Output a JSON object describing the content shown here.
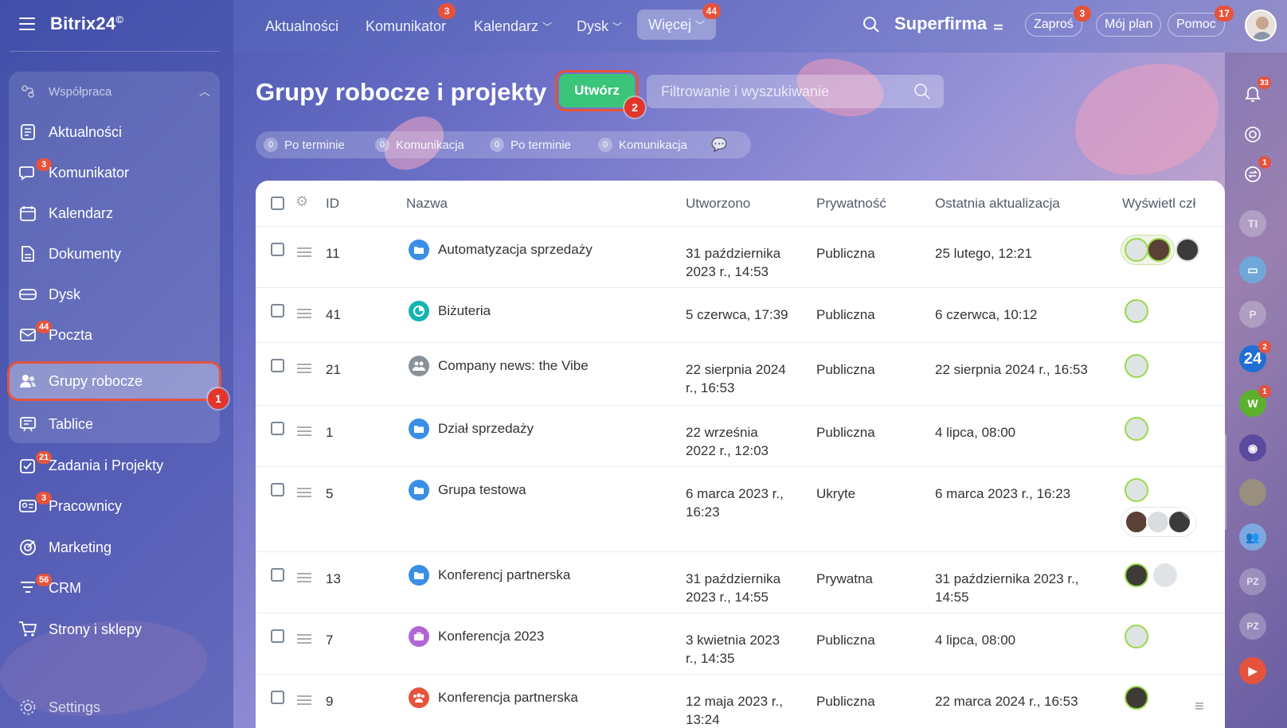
{
  "brand": {
    "name": "Bitrix24",
    "mark": "©"
  },
  "sidebar": {
    "group_label": "Współpraca",
    "items": [
      {
        "label": "Aktualności",
        "icon": "news-icon",
        "badge": ""
      },
      {
        "label": "Komunikator",
        "icon": "chat-icon",
        "badge": "3"
      },
      {
        "label": "Kalendarz",
        "icon": "calendar-icon",
        "badge": ""
      },
      {
        "label": "Dokumenty",
        "icon": "document-icon",
        "badge": ""
      },
      {
        "label": "Dysk",
        "icon": "disk-icon",
        "badge": ""
      },
      {
        "label": "Poczta",
        "icon": "mail-icon",
        "badge": "44"
      },
      {
        "label": "Grupy robocze",
        "icon": "people-icon",
        "badge": "",
        "active": true
      },
      {
        "label": "Tablice",
        "icon": "board-icon",
        "badge": ""
      },
      {
        "label": "Zadania i Projekty",
        "icon": "tasks-icon",
        "badge": "21"
      },
      {
        "label": "Pracownicy",
        "icon": "employees-icon",
        "badge": "3"
      },
      {
        "label": "Marketing",
        "icon": "target-icon",
        "badge": ""
      },
      {
        "label": "CRM",
        "icon": "crm-funnel-icon",
        "badge": "56"
      },
      {
        "label": "Strony i sklepy",
        "icon": "cart-icon",
        "badge": ""
      }
    ],
    "settings_label": "Settings",
    "step1": "1"
  },
  "topnav": {
    "items": [
      {
        "label": "Aktualności",
        "badge": ""
      },
      {
        "label": "Komunikator",
        "badge": "3"
      },
      {
        "label": "Kalendarz",
        "badge": ""
      },
      {
        "label": "Dysk",
        "badge": ""
      },
      {
        "label": "Więcej",
        "badge": "44"
      }
    ],
    "company": "Superfirma",
    "invite": "Zaproś",
    "invite_badge": "3",
    "plan": "Mój plan",
    "help": "Pomoc",
    "help_badge": "17"
  },
  "page": {
    "title": "Grupy robocze i projekty",
    "create_label": "Utwórz",
    "step2": "2",
    "search_placeholder": "Filtrowanie i wyszukiwanie",
    "counters": [
      {
        "n": "0",
        "label": "Po terminie"
      },
      {
        "n": "0",
        "label": "Komunikacja"
      },
      {
        "n": "0",
        "label": "Po terminie"
      },
      {
        "n": "0",
        "label": "Komunikacja"
      }
    ]
  },
  "table": {
    "columns": [
      "ID",
      "Nazwa",
      "Utworzono",
      "Prywatność",
      "Ostatnia aktualizacja",
      "Wyświetl czł"
    ],
    "rows": [
      {
        "id": "11",
        "name": "Automatyzacja sprzedaży",
        "icon": "folder-icon",
        "icon_color": "#3b8ee6",
        "created": [
          "31 października",
          "2023 r., 14:53"
        ],
        "privacy": "Publiczna",
        "updated": [
          "25 lutego, 12:21"
        ]
      },
      {
        "id": "41",
        "name": "Biżuteria",
        "icon": "pie-icon",
        "icon_color": "#12b5b0",
        "created": [
          "5 czerwca, 17:39"
        ],
        "privacy": "Publiczna",
        "updated": [
          "6 czerwca, 10:12"
        ]
      },
      {
        "id": "21",
        "name": "Company news: the Vibe",
        "icon": "group-icon",
        "icon_color": "#8a9199",
        "created": [
          "22 sierpnia 2024",
          "r., 16:53"
        ],
        "privacy": "Publiczna",
        "updated": [
          "22 sierpnia 2024 r., 16:53"
        ]
      },
      {
        "id": "1",
        "name": "Dział sprzedaży",
        "icon": "folder-icon",
        "icon_color": "#3b8ee6",
        "created": [
          "22 września",
          "2022 r., 12:03"
        ],
        "privacy": "Publiczna",
        "updated": [
          "4 lipca, 08:00"
        ]
      },
      {
        "id": "5",
        "name": "Grupa testowa",
        "icon": "folder-icon",
        "icon_color": "#3b8ee6",
        "created": [
          "6 marca 2023 r.,",
          "16:23"
        ],
        "privacy": "Ukryte",
        "updated": [
          "6 marca 2023 r., 16:23"
        ]
      },
      {
        "id": "13",
        "name": "Konferencj partnerska",
        "icon": "folder-icon",
        "icon_color": "#3b8ee6",
        "created": [
          "31 października",
          "2023 r., 14:55"
        ],
        "privacy": "Prywatna",
        "updated": [
          "31 października 2023 r.,",
          "14:55"
        ]
      },
      {
        "id": "7",
        "name": "Konferencja 2023",
        "icon": "briefcase-icon",
        "icon_color": "#b066d3",
        "created": [
          "3 kwietnia 2023",
          "r., 14:35"
        ],
        "privacy": "Publiczna",
        "updated": [
          "4 lipca, 08:00"
        ]
      },
      {
        "id": "9",
        "name": "Konferencja partnerska",
        "icon": "group-icon",
        "icon_color": "#e5533d",
        "created": [
          "12 maja 2023 r.,",
          "13:24"
        ],
        "privacy": "Publiczna",
        "updated": [
          "22 marca 2024 r., 16:53"
        ]
      }
    ]
  },
  "rail": {
    "notifications_badge": "33",
    "chat_badge": "1",
    "b24_label": "24",
    "b24_badge": "2",
    "w_label": "W",
    "w_badge": "1",
    "pz1": "PZ",
    "pz2": "PZ",
    "ti": "TI",
    "p": "P"
  },
  "colors": {
    "accent_green": "#3bc57a",
    "badge_red": "#e5533d"
  }
}
